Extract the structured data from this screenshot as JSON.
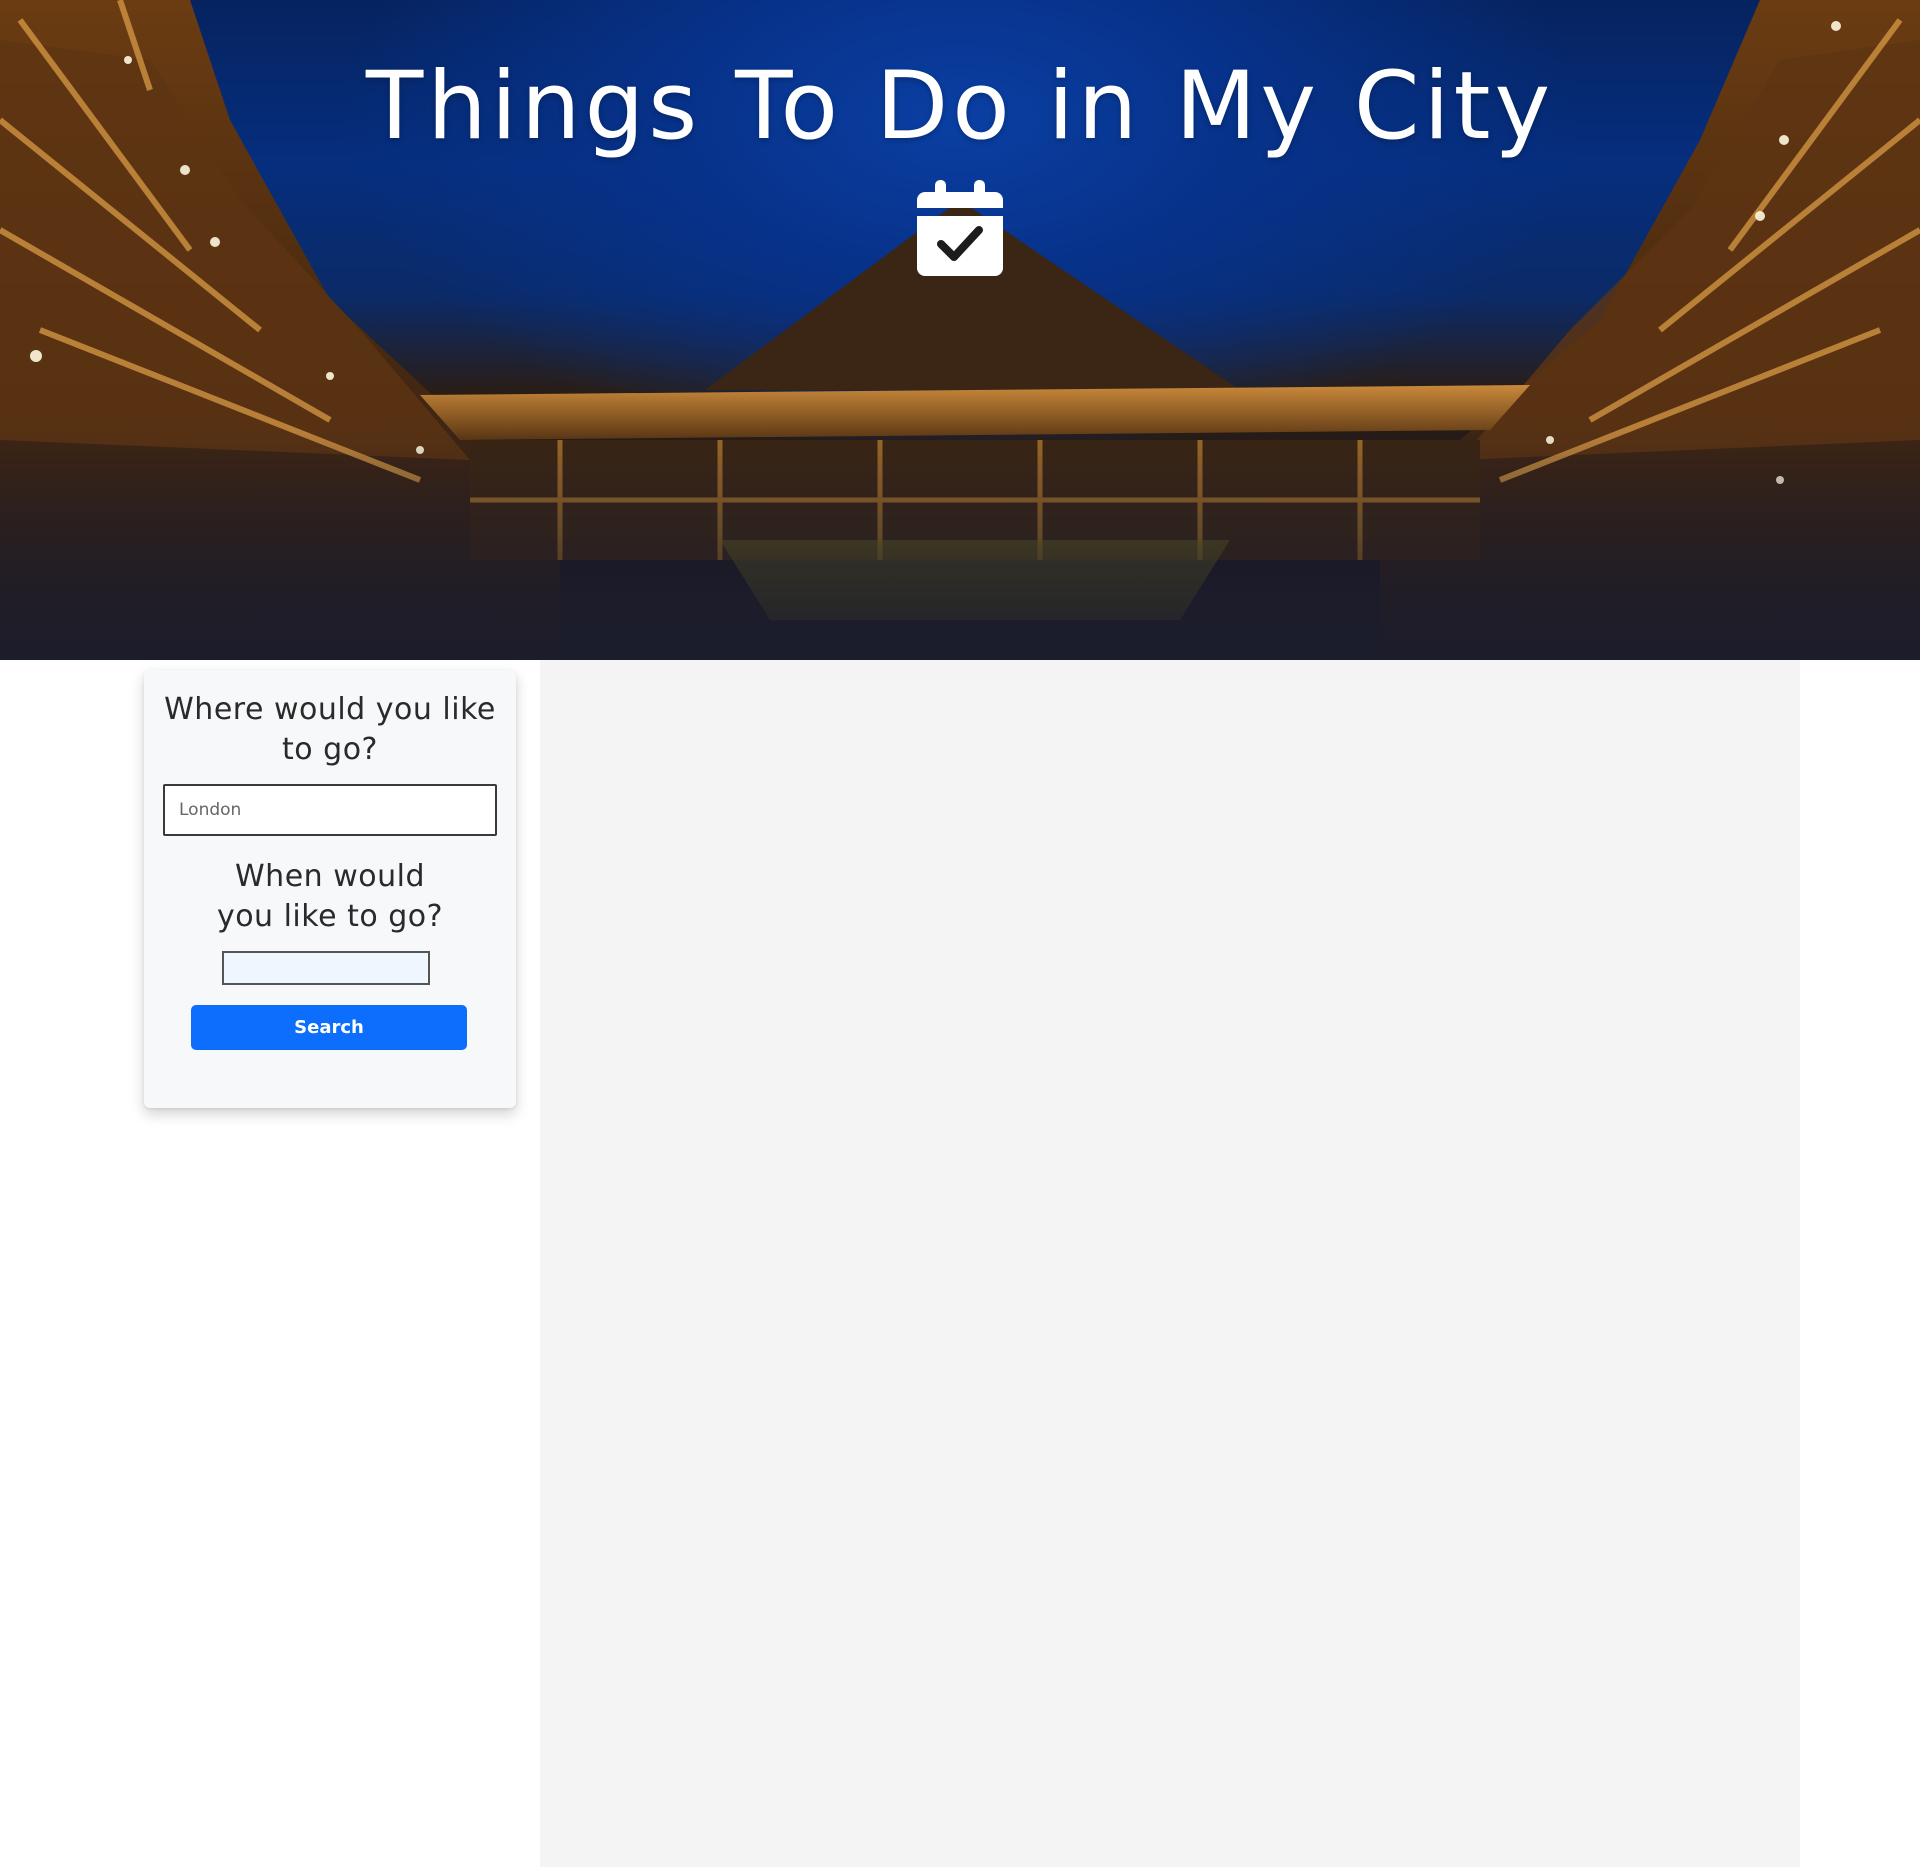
{
  "hero": {
    "title": "Things To Do in My City",
    "icon": "calendar-check-icon",
    "background": "globe-theatre-night-photo"
  },
  "search_card": {
    "where_heading": "Where would you like to go?",
    "where_placeholder": "London",
    "where_value": "",
    "when_heading": "When would you like to go?",
    "when_value": "",
    "search_label": "Search"
  },
  "colors": {
    "accent": "#0d6efd",
    "panel_bg": "#f4f4f4",
    "card_bg": "#f7f8fa",
    "sky": "#062e7e"
  }
}
